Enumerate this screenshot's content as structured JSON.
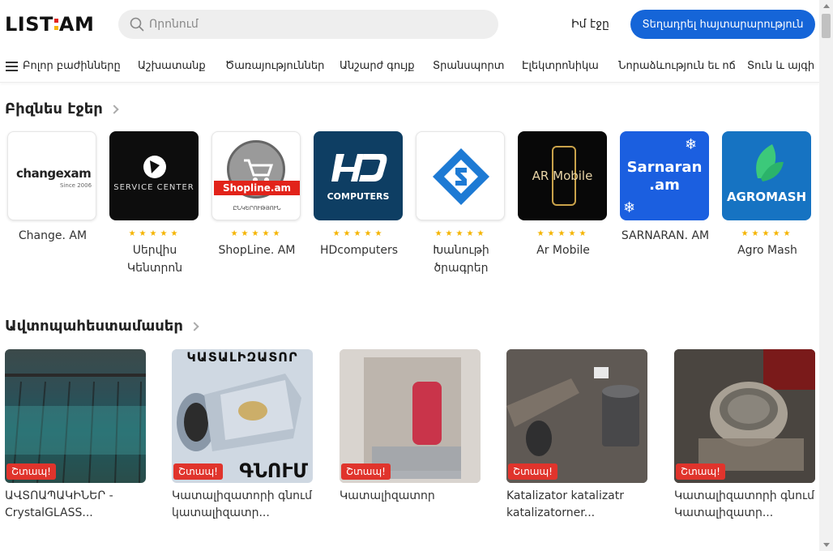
{
  "header": {
    "logo_left": "LIST",
    "logo_right": "AM",
    "search_placeholder": "Որոնում",
    "my_page": "Իմ էջը",
    "post_button": "Տեղադրել հայտարարություն"
  },
  "nav": {
    "all_categories": "Բոլոր բաժինները",
    "items": [
      "Աշխատանք",
      "Ծառայություններ",
      "Անշարժ գույք",
      "Տրանսպորտ",
      "Էլեկտրոնիկա",
      "Նորաձևություն եւ ոճ",
      "Տուն և այգի"
    ]
  },
  "business": {
    "title": "Բիզնես էջեր",
    "items": [
      {
        "name": "Change. AM",
        "logo_text": "changexam",
        "logo_sub": "Since 2006",
        "rated": false
      },
      {
        "name": "Սերվիս Կենտրոն",
        "logo_text": "SERVICE CENTER",
        "rated": true
      },
      {
        "name": "ShopLine. AM",
        "logo_text": "Shopline.am",
        "logo_sub": "ԸՆԿԵՐՈՒԹՅՈՒՆ",
        "rated": true
      },
      {
        "name": "HDcomputers",
        "logo_text": "COMPUTERS",
        "rated": true
      },
      {
        "name": "Խանութի ծրագրեր",
        "rated": true
      },
      {
        "name": "Ar Mobile",
        "logo_text": "AR Mobile",
        "rated": true
      },
      {
        "name": "SARNARAN. AM",
        "logo_text": "Sarnaran .am",
        "rated": false
      },
      {
        "name": "Agro Mash",
        "logo_text": "AGROMASH",
        "rated": true
      }
    ]
  },
  "auto": {
    "title": "Ավտոպահեստամասեր",
    "urgent_label": "Շտապ!",
    "items": [
      {
        "title": "ԱՎՏՈԱՊԱԿԻՆԵՐ - CrystalGLASS..."
      },
      {
        "title": "Կատալիզատորի գնում կատալիզատր..."
      },
      {
        "title": "Կատալիզատոր"
      },
      {
        "title": "Katalizator katalizatr katalizatorner..."
      },
      {
        "title": "Կատալիզատորի գնում Կատալիզատր..."
      }
    ],
    "image_text": {
      "card2_top": "ԿԱՏԱԼԻԶԱՏՈՐ",
      "card2_bottom": "ԳՆՈՒՄ"
    }
  },
  "colors": {
    "accent": "#1565d8",
    "urgent": "#e0342c",
    "star": "#f5b400",
    "logo_red": "#e2231a",
    "logo_yellow": "#f7b500"
  }
}
